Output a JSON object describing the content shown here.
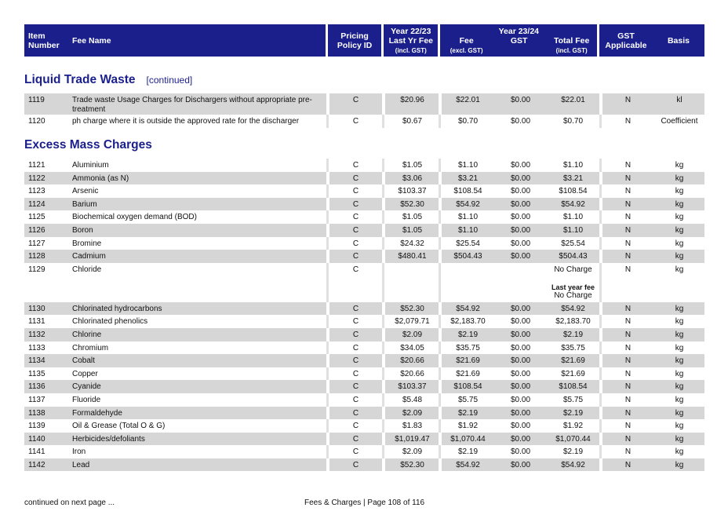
{
  "header": {
    "item_number": "Item Number",
    "fee_name": "Fee Name",
    "pricing_policy": "Pricing Policy ID",
    "year_prev": "Year 22/23",
    "last_yr_fee": "Last Yr Fee",
    "incl_gst": "(incl. GST)",
    "year_curr": "Year 23/24",
    "fee": "Fee",
    "excl_gst": "(excl. GST)",
    "gst": "GST",
    "total_fee": "Total Fee",
    "total_incl_gst": "(incl. GST)",
    "gst_applicable": "GST Applicable",
    "basis": "Basis"
  },
  "section1": {
    "title": "Liquid Trade Waste",
    "continued": "[continued]"
  },
  "section1_rows": [
    {
      "num": "1119",
      "name": "Trade waste Usage Charges for Dischargers without appropriate pre-treatment",
      "policy": "C",
      "last": "$20.96",
      "fee": "$22.01",
      "gst": "$0.00",
      "total": "$22.01",
      "app": "N",
      "basis": "kl"
    },
    {
      "num": "1120",
      "name": "ph charge where it is outside the approved rate for the discharger",
      "policy": "C",
      "last": "$0.67",
      "fee": "$0.70",
      "gst": "$0.00",
      "total": "$0.70",
      "app": "N",
      "basis": "Coefficient"
    }
  ],
  "section2": {
    "title": "Excess Mass Charges"
  },
  "section2_rows": [
    {
      "num": "1121",
      "name": "Aluminium",
      "policy": "C",
      "last": "$1.05",
      "fee": "$1.10",
      "gst": "$0.00",
      "total": "$1.10",
      "app": "N",
      "basis": "kg"
    },
    {
      "num": "1122",
      "name": "Ammonia (as N)",
      "policy": "C",
      "last": "$3.06",
      "fee": "$3.21",
      "gst": "$0.00",
      "total": "$3.21",
      "app": "N",
      "basis": "kg"
    },
    {
      "num": "1123",
      "name": "Arsenic",
      "policy": "C",
      "last": "$103.37",
      "fee": "$108.54",
      "gst": "$0.00",
      "total": "$108.54",
      "app": "N",
      "basis": "kg"
    },
    {
      "num": "1124",
      "name": "Barium",
      "policy": "C",
      "last": "$52.30",
      "fee": "$54.92",
      "gst": "$0.00",
      "total": "$54.92",
      "app": "N",
      "basis": "kg"
    },
    {
      "num": "1125",
      "name": "Biochemical oxygen demand (BOD)",
      "policy": "C",
      "last": "$1.05",
      "fee": "$1.10",
      "gst": "$0.00",
      "total": "$1.10",
      "app": "N",
      "basis": "kg"
    },
    {
      "num": "1126",
      "name": "Boron",
      "policy": "C",
      "last": "$1.05",
      "fee": "$1.10",
      "gst": "$0.00",
      "total": "$1.10",
      "app": "N",
      "basis": "kg"
    },
    {
      "num": "1127",
      "name": "Bromine",
      "policy": "C",
      "last": "$24.32",
      "fee": "$25.54",
      "gst": "$0.00",
      "total": "$25.54",
      "app": "N",
      "basis": "kg"
    },
    {
      "num": "1128",
      "name": "Cadmium",
      "policy": "C",
      "last": "$480.41",
      "fee": "$504.43",
      "gst": "$0.00",
      "total": "$504.43",
      "app": "N",
      "basis": "kg"
    },
    {
      "num": "1129",
      "name": "Chloride",
      "policy": "C",
      "last": "",
      "fee": "",
      "gst": "",
      "total": "No Charge",
      "last_year_label": "Last year fee",
      "last_year_value": "No Charge",
      "app": "N",
      "basis": "kg"
    },
    {
      "num": "1130",
      "name": "Chlorinated hydrocarbons",
      "policy": "C",
      "last": "$52.30",
      "fee": "$54.92",
      "gst": "$0.00",
      "total": "$54.92",
      "app": "N",
      "basis": "kg"
    },
    {
      "num": "1131",
      "name": "Chlorinated phenolics",
      "policy": "C",
      "last": "$2,079.71",
      "fee": "$2,183.70",
      "gst": "$0.00",
      "total": "$2,183.70",
      "app": "N",
      "basis": "kg"
    },
    {
      "num": "1132",
      "name": "Chlorine",
      "policy": "C",
      "last": "$2.09",
      "fee": "$2.19",
      "gst": "$0.00",
      "total": "$2.19",
      "app": "N",
      "basis": "kg"
    },
    {
      "num": "1133",
      "name": "Chromium",
      "policy": "C",
      "last": "$34.05",
      "fee": "$35.75",
      "gst": "$0.00",
      "total": "$35.75",
      "app": "N",
      "basis": "kg"
    },
    {
      "num": "1134",
      "name": "Cobalt",
      "policy": "C",
      "last": "$20.66",
      "fee": "$21.69",
      "gst": "$0.00",
      "total": "$21.69",
      "app": "N",
      "basis": "kg"
    },
    {
      "num": "1135",
      "name": "Copper",
      "policy": "C",
      "last": "$20.66",
      "fee": "$21.69",
      "gst": "$0.00",
      "total": "$21.69",
      "app": "N",
      "basis": "kg"
    },
    {
      "num": "1136",
      "name": "Cyanide",
      "policy": "C",
      "last": "$103.37",
      "fee": "$108.54",
      "gst": "$0.00",
      "total": "$108.54",
      "app": "N",
      "basis": "kg"
    },
    {
      "num": "1137",
      "name": "Fluoride",
      "policy": "C",
      "last": "$5.48",
      "fee": "$5.75",
      "gst": "$0.00",
      "total": "$5.75",
      "app": "N",
      "basis": "kg"
    },
    {
      "num": "1138",
      "name": "Formaldehyde",
      "policy": "C",
      "last": "$2.09",
      "fee": "$2.19",
      "gst": "$0.00",
      "total": "$2.19",
      "app": "N",
      "basis": "kg"
    },
    {
      "num": "1139",
      "name": "Oil & Grease (Total O & G)",
      "policy": "C",
      "last": "$1.83",
      "fee": "$1.92",
      "gst": "$0.00",
      "total": "$1.92",
      "app": "N",
      "basis": "kg"
    },
    {
      "num": "1140",
      "name": "Herbicides/defoliants",
      "policy": "C",
      "last": "$1,019.47",
      "fee": "$1,070.44",
      "gst": "$0.00",
      "total": "$1,070.44",
      "app": "N",
      "basis": "kg"
    },
    {
      "num": "1141",
      "name": "Iron",
      "policy": "C",
      "last": "$2.09",
      "fee": "$2.19",
      "gst": "$0.00",
      "total": "$2.19",
      "app": "N",
      "basis": "kg"
    },
    {
      "num": "1142",
      "name": "Lead",
      "policy": "C",
      "last": "$52.30",
      "fee": "$54.92",
      "gst": "$0.00",
      "total": "$54.92",
      "app": "N",
      "basis": "kg"
    }
  ],
  "footer": {
    "continued": "continued on next page ...",
    "page": "Fees & Charges | Page 108 of 116"
  }
}
